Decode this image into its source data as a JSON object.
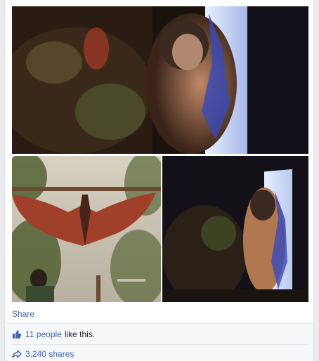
{
  "post": {
    "share_label": "Share",
    "likes": {
      "count_label": "11 people",
      "suffix": "like this."
    },
    "shares": {
      "label": "3,240 shares"
    }
  },
  "colors": {
    "link": "#4267b2",
    "footer_bg": "#f6f7f9"
  }
}
